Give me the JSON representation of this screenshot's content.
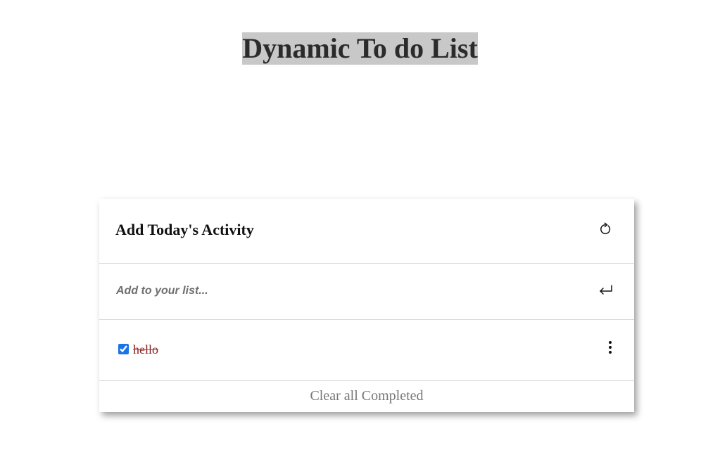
{
  "page": {
    "title": "Dynamic To do List"
  },
  "card": {
    "header": {
      "title": "Add Today's Activity",
      "refresh_icon": "refresh-icon"
    },
    "input": {
      "placeholder": "Add to your list...",
      "value": "",
      "enter_icon": "enter-return-icon"
    },
    "items": [
      {
        "text": "hello",
        "completed": true,
        "menu_icon": "more-vertical-icon"
      }
    ],
    "footer": {
      "clear_label": "Clear all Completed"
    }
  },
  "colors": {
    "title_highlight": "#c8c8c8",
    "completed_text": "#8b1a1a",
    "strike": "#c0392b",
    "divider": "#d9d9d9",
    "footer_text": "#777777"
  }
}
